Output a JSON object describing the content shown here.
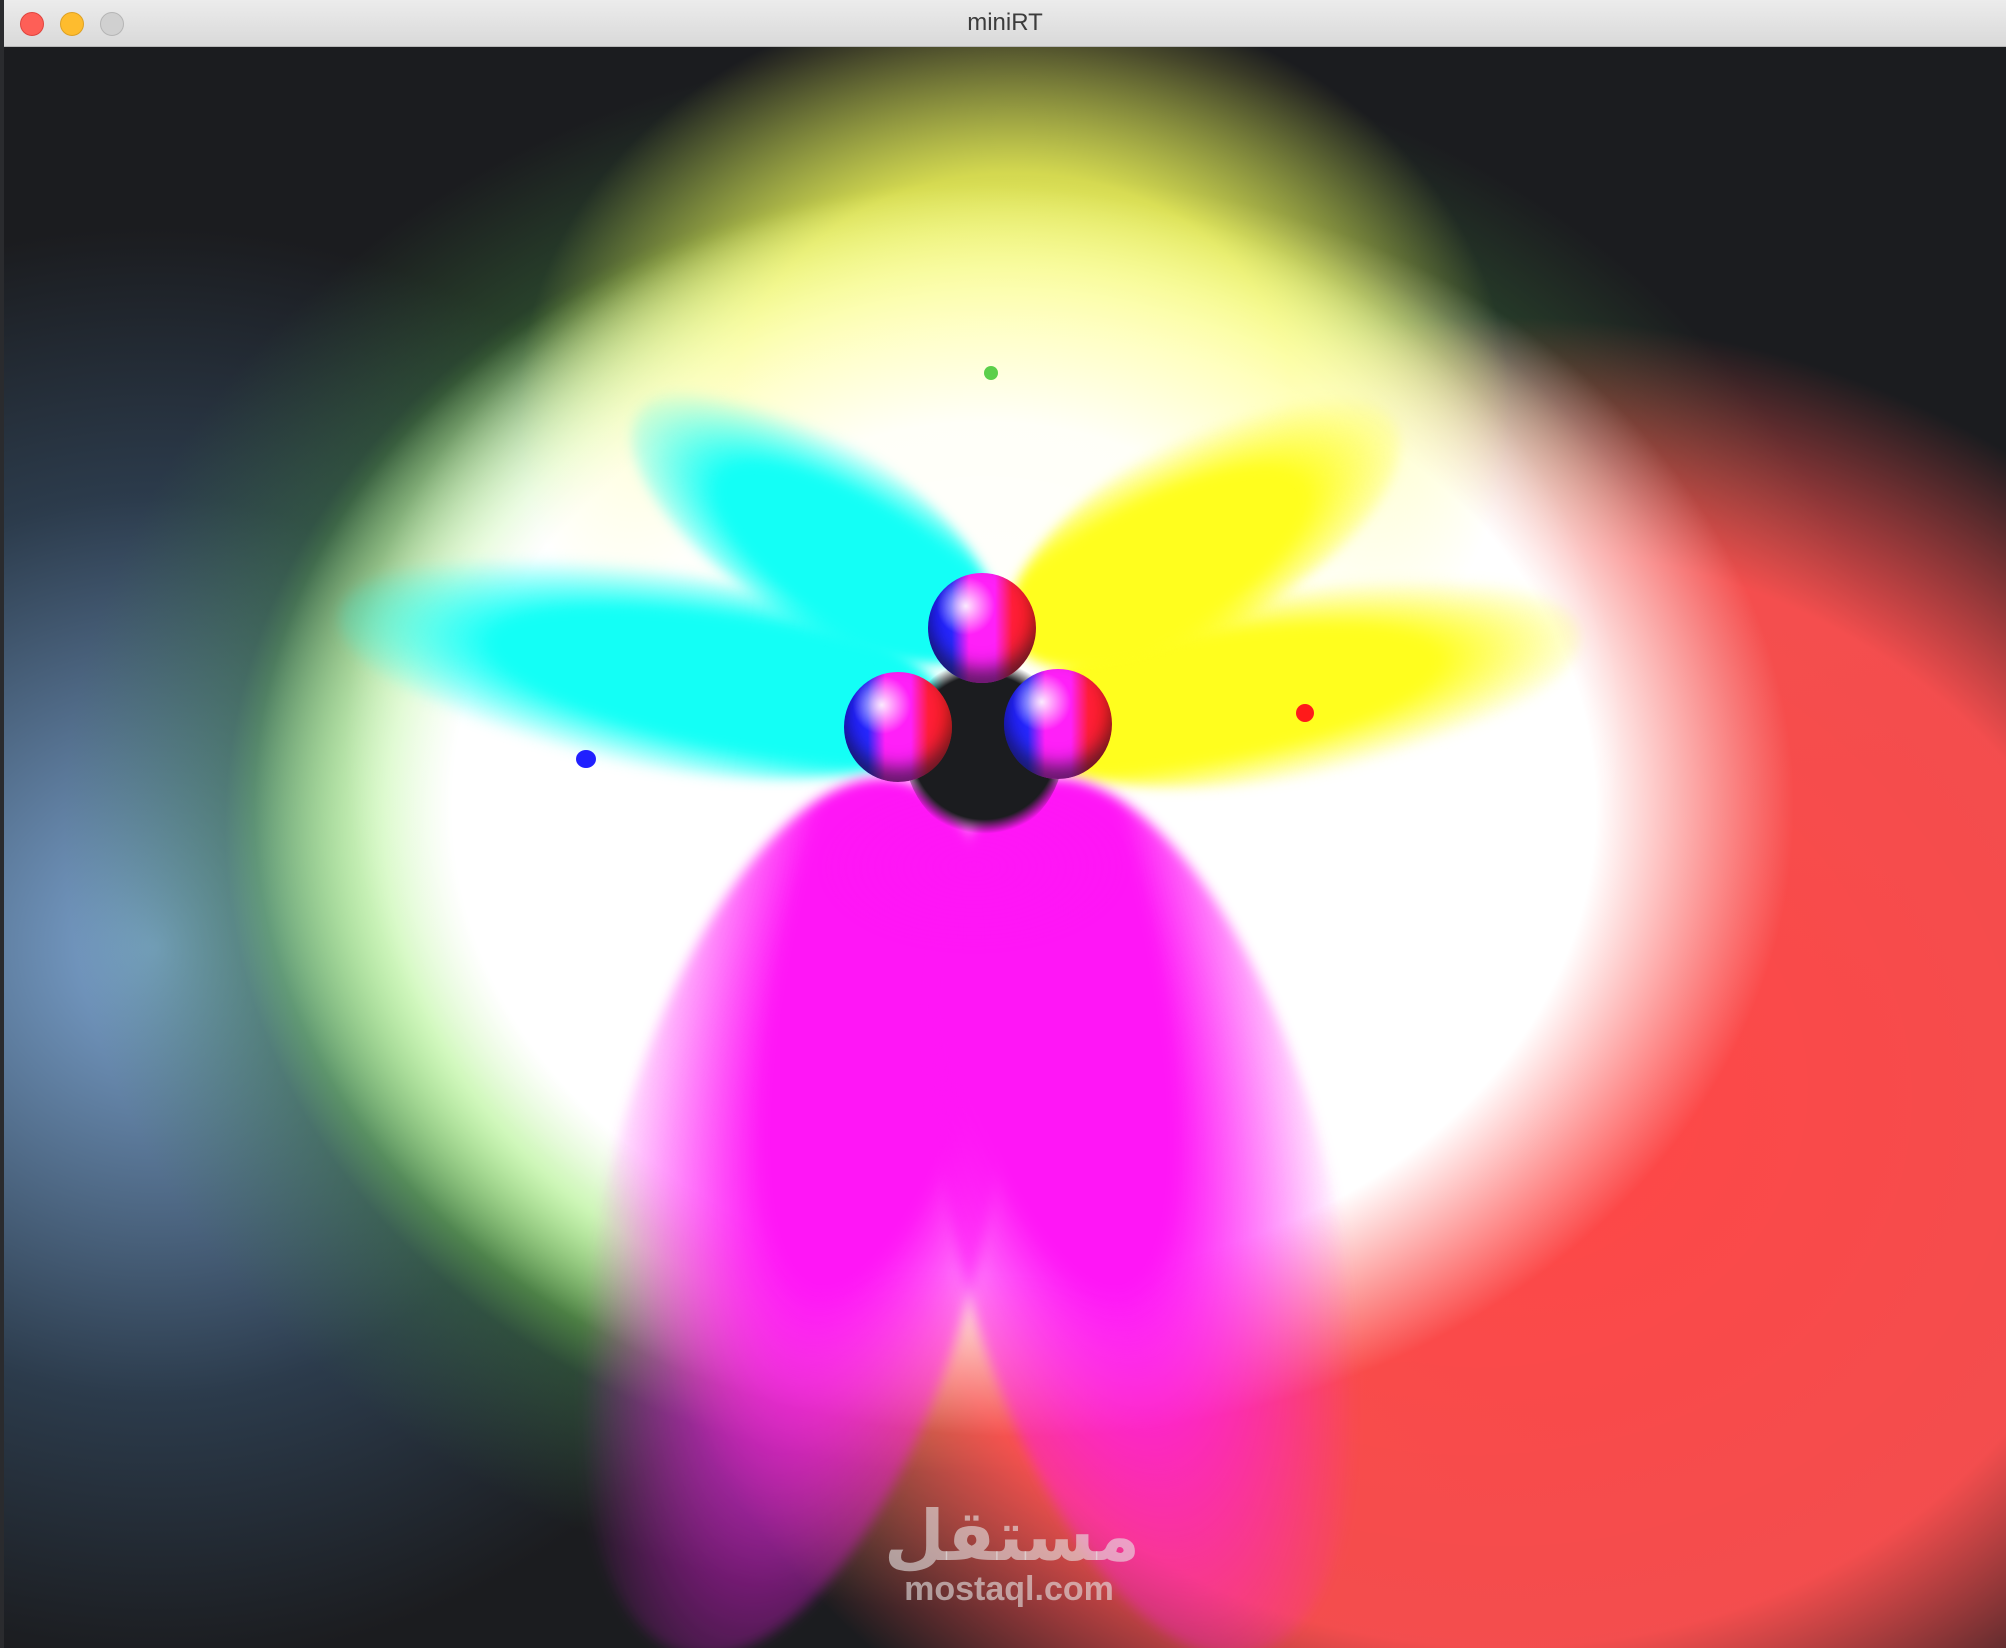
{
  "window": {
    "title": "miniRT",
    "controls": {
      "close_icon": "close-icon",
      "minimize_icon": "minimize-icon",
      "maximize_icon": "maximize-icon"
    }
  },
  "scene": {
    "background": "#1b1c1f",
    "colors": {
      "cyan": "#13fff6",
      "yellow": "#fffe1e",
      "magenta": "#ff16f6",
      "red": "#ff4444",
      "green_light": "#5bcf4a",
      "red_light": "#ff1a1a",
      "blue_light": "#2020ff"
    }
  },
  "watermark": {
    "arabic": "مستقل",
    "latin": "mostaql.com"
  }
}
